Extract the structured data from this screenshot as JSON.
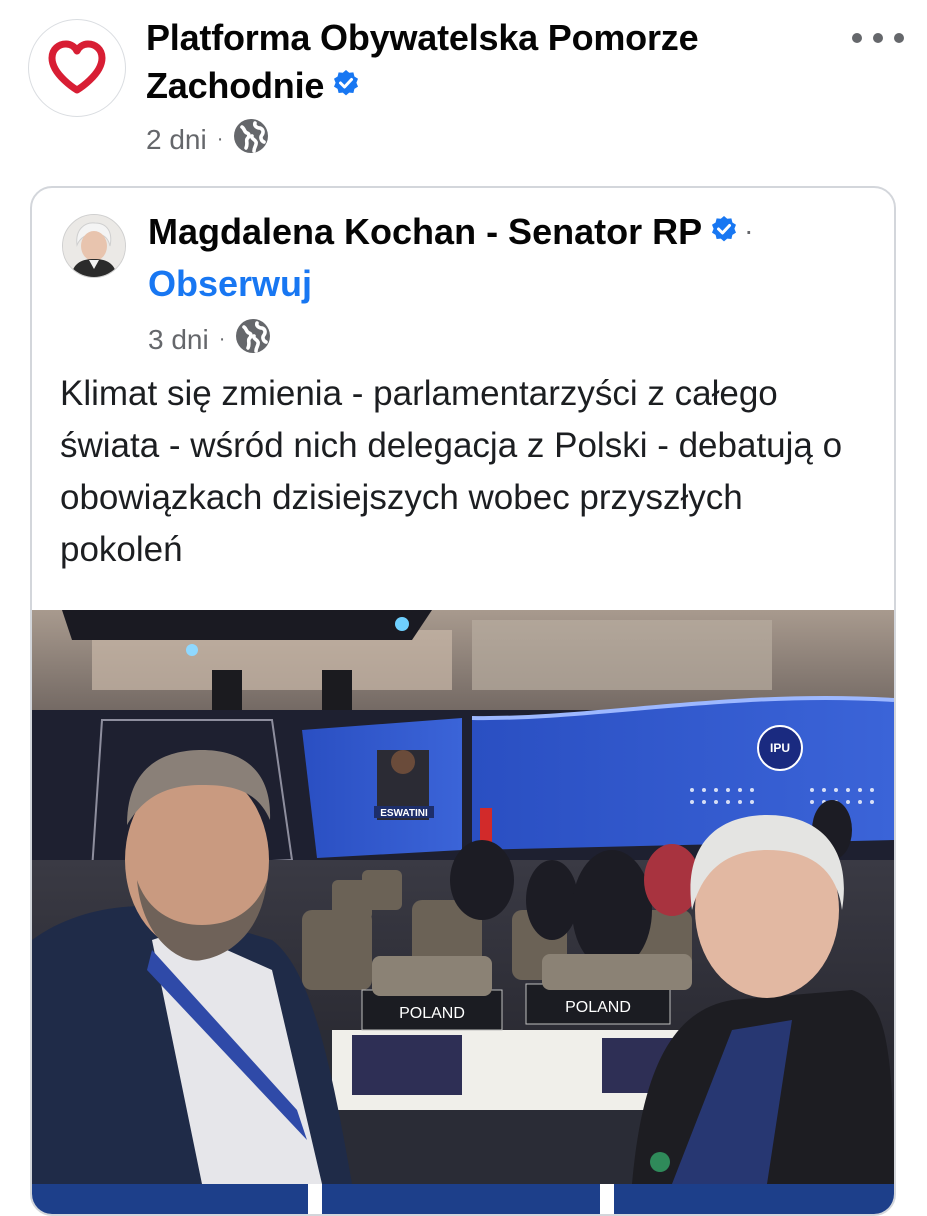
{
  "post": {
    "page_name": "Platforma Obywatelska Pomorze Zachodnie",
    "time": "2 dni",
    "audience_icon": "globe-icon",
    "verified_icon": "verified-badge-icon",
    "brand_color": "#d81e34",
    "accent_color": "#1877f2"
  },
  "shared_post": {
    "author": "Magdalena Kochan - Senator RP",
    "separator": "·",
    "follow_label": "Obserwuj",
    "time": "3 dni",
    "text": "Klimat się zmienia - parlamentarzyści z całego świata - wśród nich delegacja z Polski - debatują o obowiązkach dzisiejszych wobec przyszłych pokoleń",
    "photo": {
      "nameplate_left": "POLAND",
      "nameplate_right": "POLAND",
      "screen_label": "ESWATINI",
      "event_logo": "IPU"
    }
  },
  "meta_sep": "·"
}
